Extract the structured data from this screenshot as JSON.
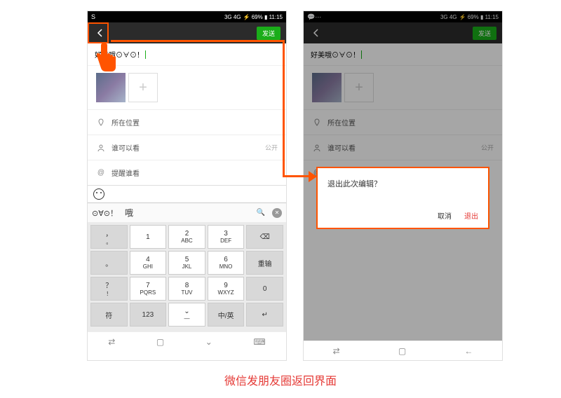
{
  "status": {
    "left_icon": "S",
    "right_text": "⚡ 69% ▮ 11:15",
    "signal": "3G 4G"
  },
  "header": {
    "send": "发送"
  },
  "post": {
    "text": "好美哦⊙∀⊙！",
    "add": "+"
  },
  "rows": {
    "location": "所在位置",
    "visibility": "谁可以看",
    "visibility_value": "公开",
    "mention": "提醒谁看"
  },
  "suggest": {
    "symbols": "⊙∀⊙！",
    "word": "哦",
    "close": "✕"
  },
  "keys": {
    "r1": [
      {
        "gray": true,
        "top": "，",
        "bot": "。"
      },
      {
        "top": "1",
        "bot": ""
      },
      {
        "top": "2",
        "bot": "ABC"
      },
      {
        "top": "3",
        "bot": "DEF"
      },
      {
        "gray": true,
        "top": "⌫",
        "bot": ""
      }
    ],
    "r2": [
      {
        "gray": true,
        "top": "。",
        "bot": ""
      },
      {
        "top": "4",
        "bot": "GHI"
      },
      {
        "top": "5",
        "bot": "JKL"
      },
      {
        "top": "6",
        "bot": "MNO"
      },
      {
        "gray": true,
        "top": "重输",
        "bot": ""
      }
    ],
    "r3": [
      {
        "gray": true,
        "top": "？",
        "bot": "！"
      },
      {
        "top": "7",
        "bot": "PQRS"
      },
      {
        "top": "8",
        "bot": "TUV"
      },
      {
        "top": "9",
        "bot": "WXYZ"
      },
      {
        "gray": true,
        "top": "0",
        "bot": ""
      }
    ],
    "r4": [
      {
        "gray": true,
        "top": "符",
        "bot": ""
      },
      {
        "gray": true,
        "top": "123",
        "bot": ""
      },
      {
        "top": "⌄",
        "bot": "—"
      },
      {
        "gray": true,
        "top": "中/英",
        "bot": ""
      },
      {
        "gray": true,
        "top": "↵",
        "bot": ""
      }
    ]
  },
  "nav": {
    "a": "⇄",
    "b": "▢",
    "c": "⌄",
    "d": "⌨"
  },
  "nav2": {
    "a": "⇄",
    "b": "▢",
    "c": "←"
  },
  "dialog": {
    "q": "退出此次编辑？",
    "cancel": "取消",
    "exit": "退出"
  },
  "caption": "微信发朋友圈返回界面"
}
